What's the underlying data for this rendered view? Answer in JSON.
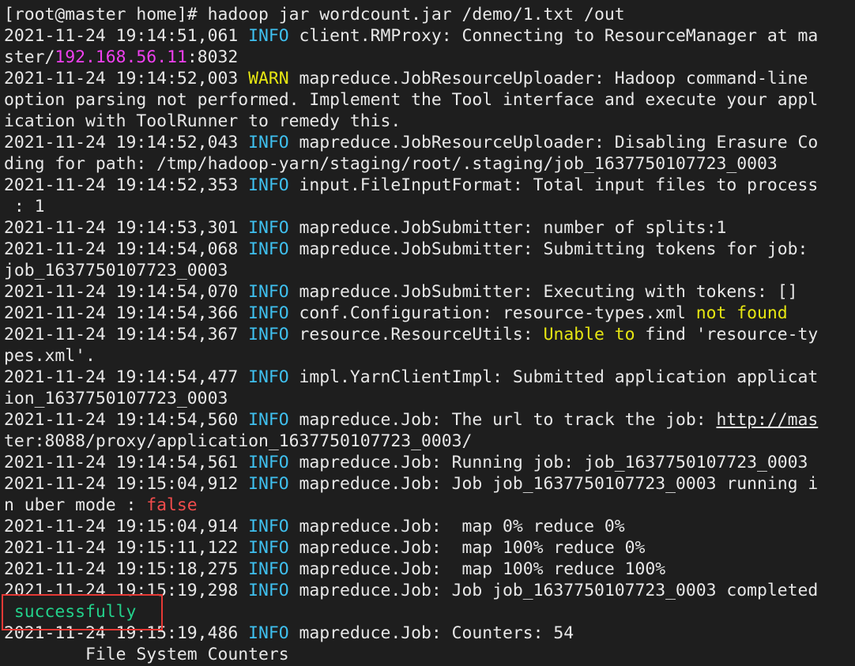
{
  "terminal": {
    "lines": [
      [
        {
          "t": "[root@master home]# hadoop jar wordcount.jar /demo/1.txt /out",
          "c": ""
        }
      ],
      [
        {
          "t": "2021-11-24 19:14:51,061 ",
          "c": ""
        },
        {
          "t": "INFO",
          "c": "info"
        },
        {
          "t": " client.RMProxy: Connecting to ResourceManager at ma",
          "c": ""
        }
      ],
      [
        {
          "t": "ster/",
          "c": ""
        },
        {
          "t": "192.168.56.11",
          "c": "ip"
        },
        {
          "t": ":8032",
          "c": ""
        }
      ],
      [
        {
          "t": "2021-11-24 19:14:52,003 ",
          "c": ""
        },
        {
          "t": "WARN",
          "c": "warn"
        },
        {
          "t": " mapreduce.JobResourceUploader: Hadoop command-line",
          "c": ""
        }
      ],
      [
        {
          "t": "option parsing not performed. Implement the Tool interface and execute your appl",
          "c": ""
        }
      ],
      [
        {
          "t": "ication with ToolRunner to remedy this.",
          "c": ""
        }
      ],
      [
        {
          "t": "2021-11-24 19:14:52,043 ",
          "c": ""
        },
        {
          "t": "INFO",
          "c": "info"
        },
        {
          "t": " mapreduce.JobResourceUploader: Disabling Erasure Co",
          "c": ""
        }
      ],
      [
        {
          "t": "ding for path: /tmp/hadoop-yarn/staging/root/.staging/job_1637750107723_0003",
          "c": ""
        }
      ],
      [
        {
          "t": "2021-11-24 19:14:52,353 ",
          "c": ""
        },
        {
          "t": "INFO",
          "c": "info"
        },
        {
          "t": " input.FileInputFormat: Total input files to process",
          "c": ""
        }
      ],
      [
        {
          "t": " : 1",
          "c": ""
        }
      ],
      [
        {
          "t": "2021-11-24 19:14:53,301 ",
          "c": ""
        },
        {
          "t": "INFO",
          "c": "info"
        },
        {
          "t": " mapreduce.JobSubmitter: number of splits:1",
          "c": ""
        }
      ],
      [
        {
          "t": "2021-11-24 19:14:54,068 ",
          "c": ""
        },
        {
          "t": "INFO",
          "c": "info"
        },
        {
          "t": " mapreduce.JobSubmitter: Submitting tokens for job:",
          "c": ""
        }
      ],
      [
        {
          "t": "job_1637750107723_0003",
          "c": ""
        }
      ],
      [
        {
          "t": "2021-11-24 19:14:54,070 ",
          "c": ""
        },
        {
          "t": "INFO",
          "c": "info"
        },
        {
          "t": " mapreduce.JobSubmitter: Executing with tokens: []",
          "c": ""
        }
      ],
      [
        {
          "t": "2021-11-24 19:14:54,366 ",
          "c": ""
        },
        {
          "t": "INFO",
          "c": "info"
        },
        {
          "t": " conf.Configuration: resource-types.xml ",
          "c": ""
        },
        {
          "t": "not found",
          "c": "warn"
        }
      ],
      [
        {
          "t": "2021-11-24 19:14:54,367 ",
          "c": ""
        },
        {
          "t": "INFO",
          "c": "info"
        },
        {
          "t": " resource.ResourceUtils: ",
          "c": ""
        },
        {
          "t": "Unable to",
          "c": "warn"
        },
        {
          "t": " find 'resource-ty",
          "c": ""
        }
      ],
      [
        {
          "t": "pes.xml'.",
          "c": ""
        }
      ],
      [
        {
          "t": "2021-11-24 19:14:54,477 ",
          "c": ""
        },
        {
          "t": "INFO",
          "c": "info"
        },
        {
          "t": " impl.YarnClientImpl: Submitted application applicat",
          "c": ""
        }
      ],
      [
        {
          "t": "ion_1637750107723_0003",
          "c": ""
        }
      ],
      [
        {
          "t": "2021-11-24 19:14:54,560 ",
          "c": ""
        },
        {
          "t": "INFO",
          "c": "info"
        },
        {
          "t": " mapreduce.Job: The url to track the job: ",
          "c": ""
        },
        {
          "t": "http://mas",
          "c": "link"
        }
      ],
      [
        {
          "t": "ter:8088/proxy/application_1637750107723_0003/",
          "c": ""
        }
      ],
      [
        {
          "t": "2021-11-24 19:14:54,561 ",
          "c": ""
        },
        {
          "t": "INFO",
          "c": "info"
        },
        {
          "t": " mapreduce.Job: Running job: job_1637750107723_0003",
          "c": ""
        }
      ],
      [
        {
          "t": "2021-11-24 19:15:04,912 ",
          "c": ""
        },
        {
          "t": "INFO",
          "c": "info"
        },
        {
          "t": " mapreduce.Job: Job job_1637750107723_0003 running i",
          "c": ""
        }
      ],
      [
        {
          "t": "n uber mode : ",
          "c": ""
        },
        {
          "t": "false",
          "c": "err"
        }
      ],
      [
        {
          "t": "2021-11-24 19:15:04,914 ",
          "c": ""
        },
        {
          "t": "INFO",
          "c": "info"
        },
        {
          "t": " mapreduce.Job:  map 0% reduce 0%",
          "c": ""
        }
      ],
      [
        {
          "t": "2021-11-24 19:15:11,122 ",
          "c": ""
        },
        {
          "t": "INFO",
          "c": "info"
        },
        {
          "t": " mapreduce.Job:  map 100% reduce 0%",
          "c": ""
        }
      ],
      [
        {
          "t": "2021-11-24 19:15:18,275 ",
          "c": ""
        },
        {
          "t": "INFO",
          "c": "info"
        },
        {
          "t": " mapreduce.Job:  map 100% reduce 100%",
          "c": ""
        }
      ],
      [
        {
          "t": "2021-11-24 19:15:19,298 ",
          "c": ""
        },
        {
          "t": "INFO",
          "c": "info"
        },
        {
          "t": " mapreduce.Job: Job job_1637750107723_0003 completed",
          "c": ""
        }
      ],
      [
        {
          "t": " ",
          "c": ""
        },
        {
          "t": "successfully",
          "c": "ok"
        }
      ],
      [
        {
          "t": "2021-11-24 19:15:19,486 ",
          "c": ""
        },
        {
          "t": "INFO",
          "c": "info"
        },
        {
          "t": " mapreduce.Job: Counters: 54",
          "c": ""
        }
      ],
      [
        {
          "t": "        File System Counters",
          "c": ""
        }
      ]
    ]
  },
  "colors": {
    "background": "#1e1e1e",
    "info": "#3fc0ef",
    "warn": "#e6e612",
    "ip": "#f040f0",
    "error": "#f14c4c",
    "success": "#23d18b",
    "highlight_box": "#e53935"
  }
}
